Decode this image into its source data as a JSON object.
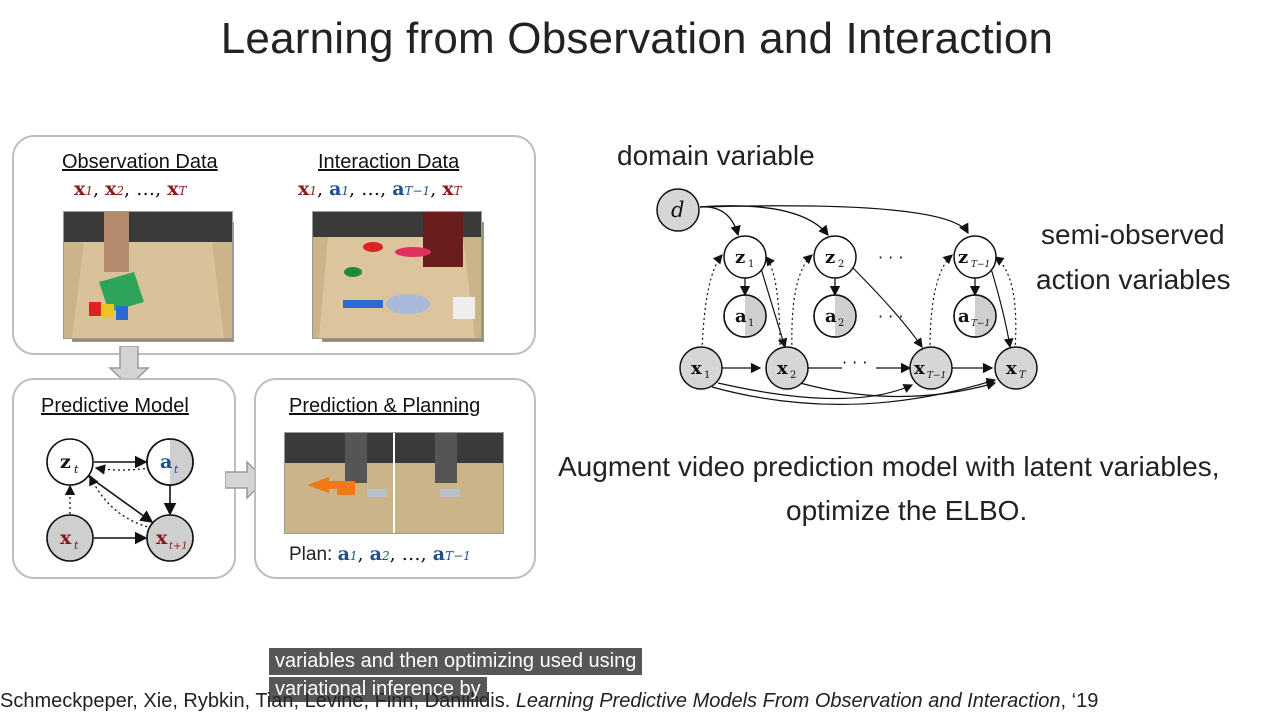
{
  "slide": {
    "title": "Learning from Observation and Interaction"
  },
  "left_diagram": {
    "observation_title": "Observation Data",
    "observation_seq": {
      "x1": "x",
      "s1": "1",
      "x2": "x",
      "s2": "2",
      "dots": "…",
      "xT": "x",
      "sT": "T"
    },
    "interaction_title": "Interaction Data",
    "interaction_seq": {
      "x1": "x",
      "s1": "1",
      "a1": "a",
      "sa1": "1",
      "aT": "a",
      "saT": "T−1",
      "xT": "x",
      "sT": "T"
    },
    "predictive_title": "Predictive Model",
    "nodes": {
      "z": "z",
      "z_sub": "t",
      "a": "a",
      "a_sub": "t",
      "x": "x",
      "x_sub": "t",
      "x1": "x",
      "x1_sub": "t+1"
    },
    "planning_title": "Prediction & Planning",
    "plan_label": "Plan:",
    "plan_seq": {
      "a1": "a",
      "s1": "1",
      "a2": "a",
      "s2": "2",
      "aT": "a",
      "sT": "T−1"
    }
  },
  "right_diagram": {
    "domain_label": "domain variable",
    "semi_observed_line1": "semi-observed",
    "semi_observed_line2": "action variables",
    "d_node": "d",
    "z_nodes": [
      {
        "v": "z",
        "s": "1"
      },
      {
        "v": "z",
        "s": "2"
      },
      {
        "v": "z",
        "s": "T−1"
      }
    ],
    "a_nodes": [
      {
        "v": "a",
        "s": "1"
      },
      {
        "v": "a",
        "s": "2"
      },
      {
        "v": "a",
        "s": "T−1"
      }
    ],
    "x_nodes": [
      {
        "v": "x",
        "s": "1"
      },
      {
        "v": "x",
        "s": "2"
      },
      {
        "v": "x",
        "s": "T−1"
      },
      {
        "v": "x",
        "s": "T"
      }
    ],
    "ellipsis": "· · ·"
  },
  "description": {
    "line1": "Augment video prediction model with latent variables,",
    "line2": "optimize the ELBO."
  },
  "video_caption": {
    "line1": "variables and then optimizing used using",
    "line2": "variational inference by"
  },
  "citation": {
    "authors": "Schmeckpeper, Xie, Rybkin, Tian, Levine, Finn, Daniilidis. ",
    "paper_title": "Learning Predictive Models From Observation and Interaction",
    "year": ", ‘19"
  }
}
